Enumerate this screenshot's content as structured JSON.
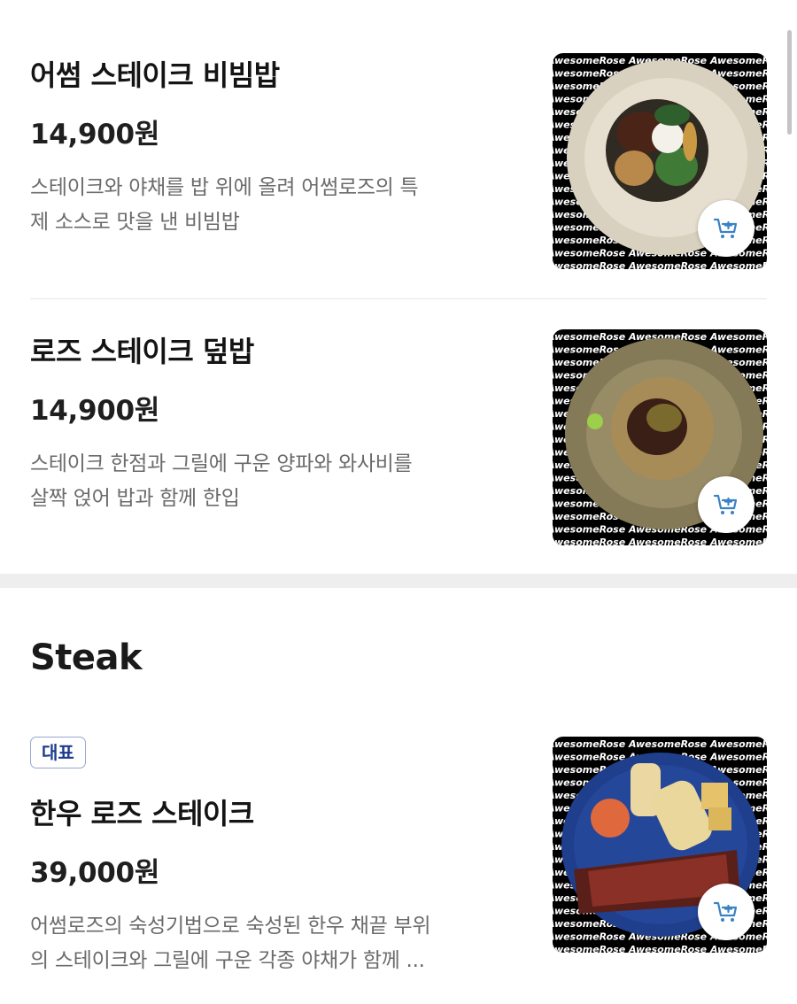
{
  "accent_color": "#3b82c4",
  "image_watermark": "AwesomeRose",
  "items": [
    {
      "name": "어썸 스테이크 비빔밥",
      "price": "14,900원",
      "desc_line1": "스테이크와 야채를 밥 위에 올려 어썸로즈의 특",
      "desc_line2": "제 소스로 맛을 낸 비빔밥",
      "cart_icon": "add-to-cart-icon"
    },
    {
      "name": "로즈 스테이크 덮밥",
      "price": "14,900원",
      "desc_line1": "스테이크 한점과 그릴에 구운 양파와 와사비를",
      "desc_line2": "살짝 얹어 밥과 함께 한입",
      "cart_icon": "add-to-cart-icon"
    }
  ],
  "steak_section": {
    "title": "Steak",
    "items": [
      {
        "badge": "대표",
        "name": "한우 로즈 스테이크",
        "price": "39,000원",
        "desc_line1": "어썸로즈의 숙성기법으로 숙성된 한우 채끝 부위",
        "desc_line2": "의 스테이크와 그릴에 구운 각종 야채가 함께 ...",
        "cart_icon": "add-to-cart-icon"
      }
    ]
  }
}
